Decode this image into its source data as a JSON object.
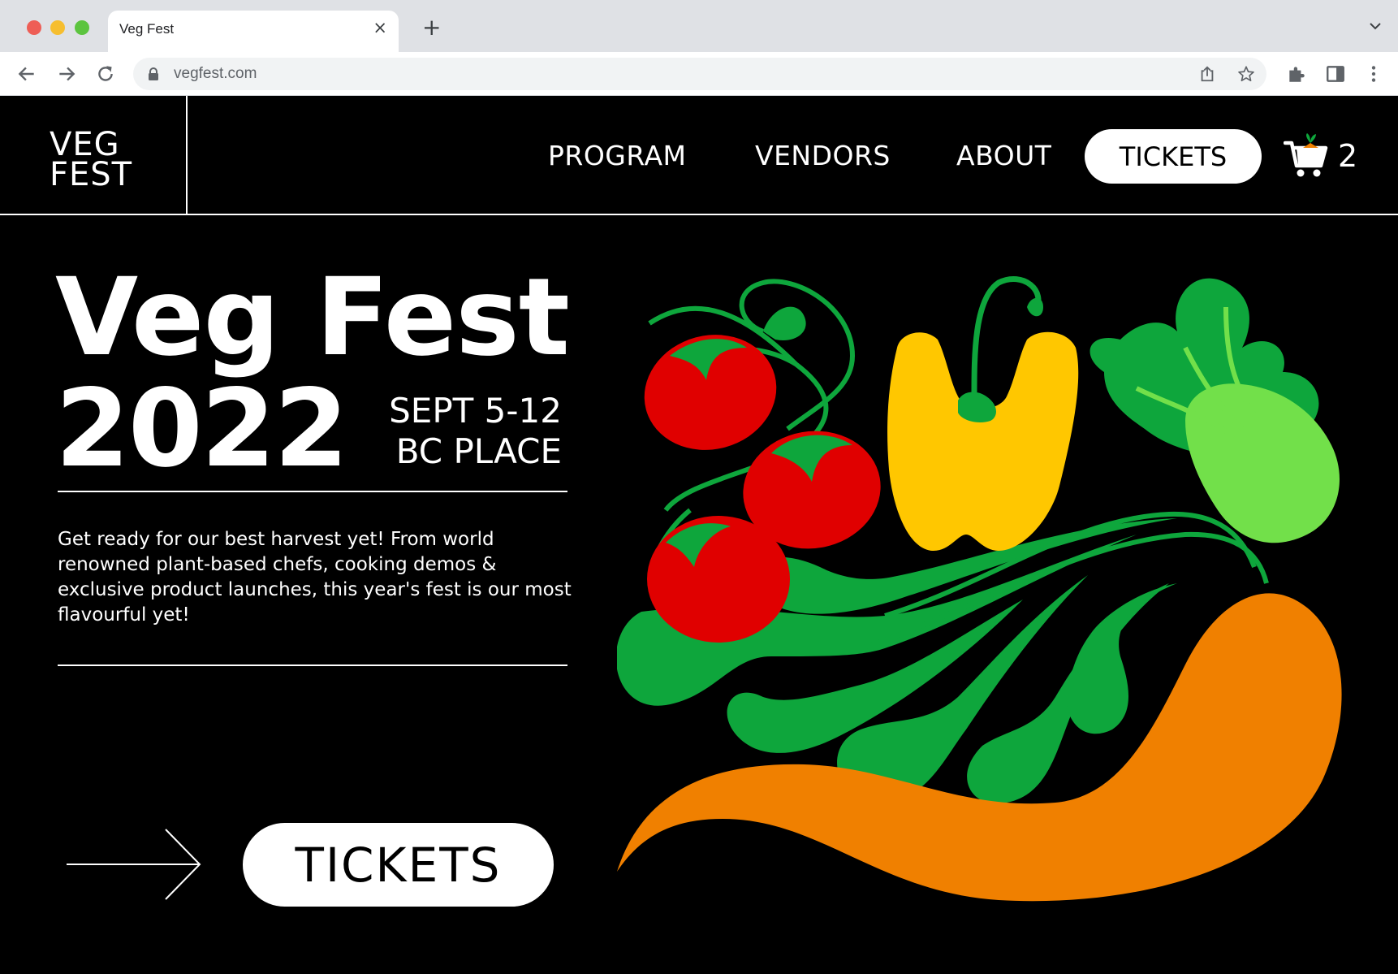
{
  "browser": {
    "tab_title": "Veg Fest",
    "tab_close": "×",
    "new_tab": "+",
    "url": "vegfest.com"
  },
  "site": {
    "logo_line1": "VEG",
    "logo_line2": "FEST",
    "nav": {
      "program": "PROGRAM",
      "vendors": "VENDORS",
      "about": "ABOUT",
      "tickets": "TICKETS"
    },
    "cart_count": "2"
  },
  "hero": {
    "title": "Veg Fest",
    "year": "2022",
    "date": "SEPT 5-12",
    "place": "BC PLACE",
    "description": "Get ready for our best harvest yet! From world renowned plant-based chefs, cooking demos & exclusive product launches, this year's fest is our most flavourful yet!",
    "cta": "TICKETS"
  },
  "colors": {
    "background": "#000000",
    "tomato": "#e00000",
    "pepper": "#ffc700",
    "leaf_dark": "#0ea63c",
    "leaf_light": "#72e04a",
    "carrot": "#f08000"
  },
  "icons": [
    "back-arrow-icon",
    "forward-arrow-icon",
    "reload-icon",
    "lock-icon",
    "share-icon",
    "star-icon",
    "puzzle-icon",
    "sidebar-icon",
    "kebab-menu-icon",
    "cart-icon",
    "arrow-right-icon"
  ]
}
